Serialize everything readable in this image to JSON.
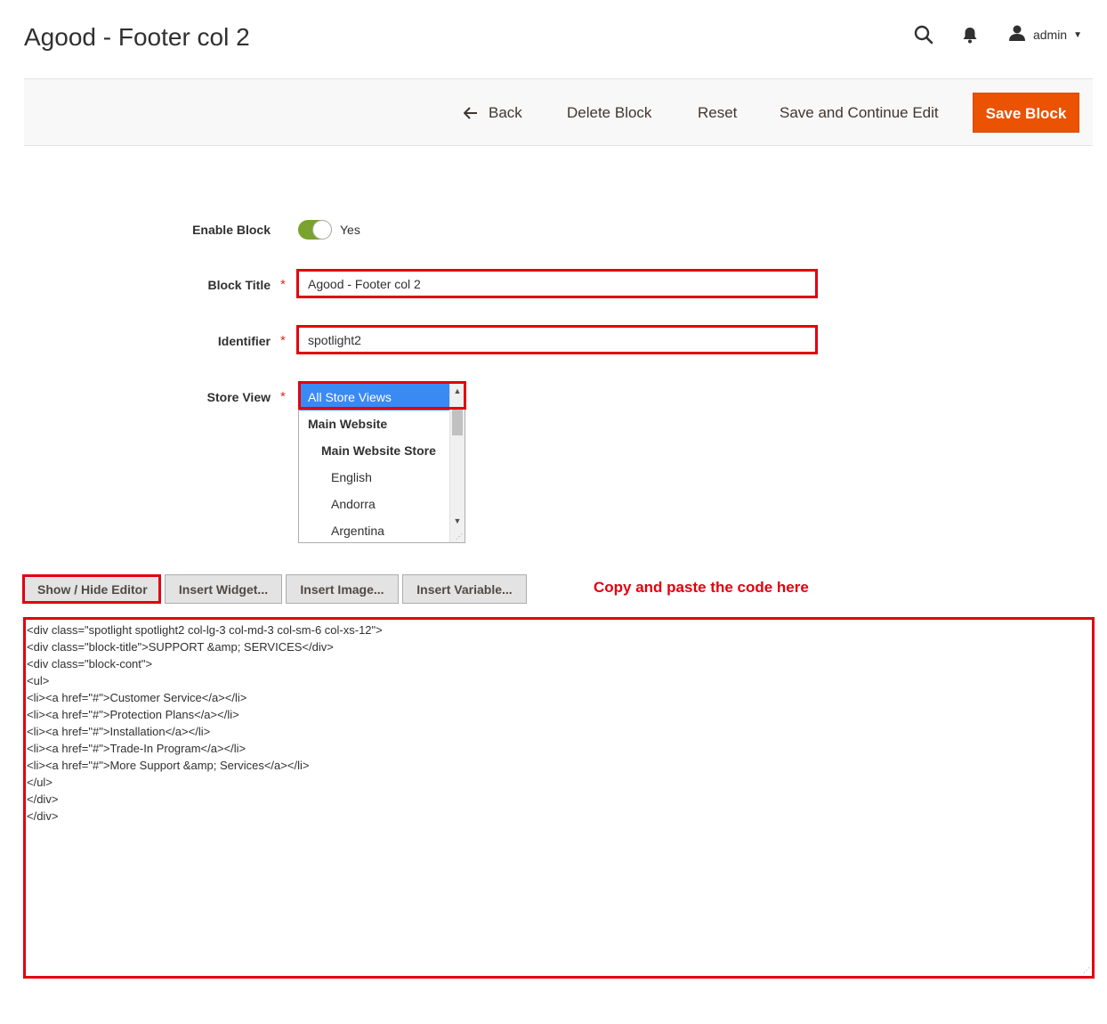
{
  "header": {
    "title": "Agood - Footer col 2",
    "user": "admin",
    "search_icon": "search-icon",
    "bell_icon": "bell-icon",
    "user_icon": "user-icon"
  },
  "actions": {
    "back": "Back",
    "delete": "Delete Block",
    "reset": "Reset",
    "save_continue": "Save and Continue Edit",
    "save": "Save Block",
    "accent": "#eb5202"
  },
  "form": {
    "enable_label": "Enable Block",
    "enable_value": "Yes",
    "title_label": "Block Title",
    "title_value": "Agood - Footer col 2",
    "identifier_label": "Identifier",
    "identifier_value": "spotlight2",
    "store_view_label": "Store View",
    "store_views": [
      {
        "label": "All Store Views",
        "selected": true
      },
      {
        "label": "Main Website"
      },
      {
        "label": "Main Website Store"
      },
      {
        "label": "English"
      },
      {
        "label": "Andorra"
      },
      {
        "label": "Argentina"
      }
    ]
  },
  "editor": {
    "show_hide": "Show / Hide Editor",
    "insert_widget": "Insert Widget...",
    "insert_image": "Insert Image...",
    "insert_variable": "Insert Variable...",
    "annotation": "Copy and paste the code here",
    "highlight_color": "#e2000e",
    "code_lines": [
      "<div class=\"spotlight spotlight2 col-lg-3 col-md-3 col-sm-6 col-xs-12\">",
      "<div class=\"block-title\">SUPPORT &amp; SERVICES</div>",
      "<div class=\"block-cont\">",
      "<ul>",
      "<li><a href=\"#\">Customer Service</a></li>",
      "<li><a href=\"#\">Protection Plans</a></li>",
      "<li><a href=\"#\">Installation</a></li>",
      "<li><a href=\"#\">Trade-In Program</a></li>",
      "<li><a href=\"#\">More Support &amp; Services</a></li>",
      "</ul>",
      "</div>",
      "</div>"
    ]
  }
}
